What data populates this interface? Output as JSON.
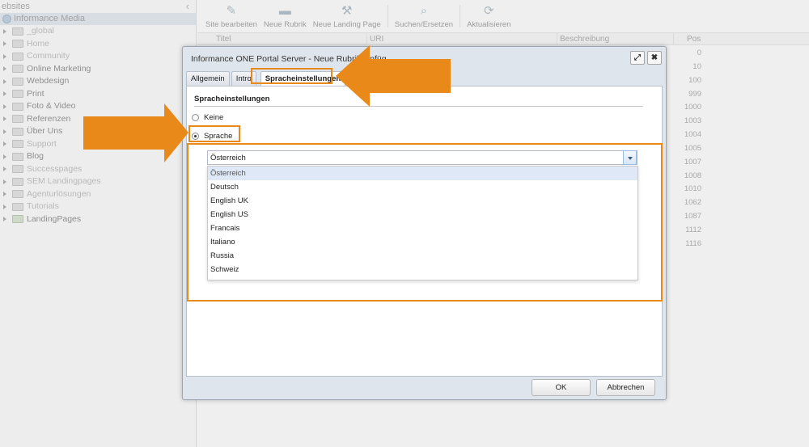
{
  "sidebar": {
    "header": "ebsites",
    "collapse_glyph": "‹",
    "root": "Informance Media",
    "items": [
      {
        "label": "_global",
        "style": "light"
      },
      {
        "label": "Home",
        "style": "light"
      },
      {
        "label": "Community",
        "style": "light"
      },
      {
        "label": "Online Marketing",
        "style": "strong"
      },
      {
        "label": "Webdesign",
        "style": "strong"
      },
      {
        "label": "Print",
        "style": "strong"
      },
      {
        "label": "Foto & Video",
        "style": "strong"
      },
      {
        "label": "Referenzen",
        "style": "strong"
      },
      {
        "label": "Über Uns",
        "style": "strong"
      },
      {
        "label": "Support",
        "style": "light"
      },
      {
        "label": "Blog",
        "style": "strong"
      },
      {
        "label": "Successpages",
        "style": "light"
      },
      {
        "label": "SEM Landingpages",
        "style": "light"
      },
      {
        "label": "Agenturlösungen",
        "style": "light"
      },
      {
        "label": "Tutorials",
        "style": "light"
      },
      {
        "label": "LandingPages",
        "style": "strong"
      }
    ]
  },
  "toolbar": {
    "site_edit": "Site bearbeiten",
    "new_rubric": "Neue Rubrik",
    "new_landing": "Neue Landing Page",
    "search_replace": "Suchen/Ersetzen",
    "refresh": "Aktualisieren"
  },
  "grid": {
    "col_title": "Titel",
    "col_uri": "URI",
    "col_desc": "Beschreibung",
    "col_pos": "Pos",
    "positions": [
      "0",
      "10",
      "100",
      "999",
      "1000",
      "1003",
      "1004",
      "1005",
      "1007",
      "1008",
      "1010",
      "1062",
      "1087",
      "1112",
      "1116"
    ]
  },
  "dialog": {
    "title": "Informance ONE Portal Server - Neue Rubrik einfüg",
    "maximize_glyph": "⤢",
    "close_glyph": "✖",
    "tabs": [
      "Allgemein",
      "Intro",
      "Spracheinstellungen"
    ],
    "section_title": "Spracheinstellungen",
    "radio_none": "Keine",
    "radio_lang": "Sprache",
    "combo_value": "Österreich",
    "options": [
      "Österreich",
      "Deutsch",
      "English UK",
      "English US",
      "Francais",
      "Italiano",
      "Russia",
      "Schweiz"
    ],
    "ok": "OK",
    "cancel": "Abbrechen"
  },
  "colors": {
    "annotation": "#e8891a"
  }
}
